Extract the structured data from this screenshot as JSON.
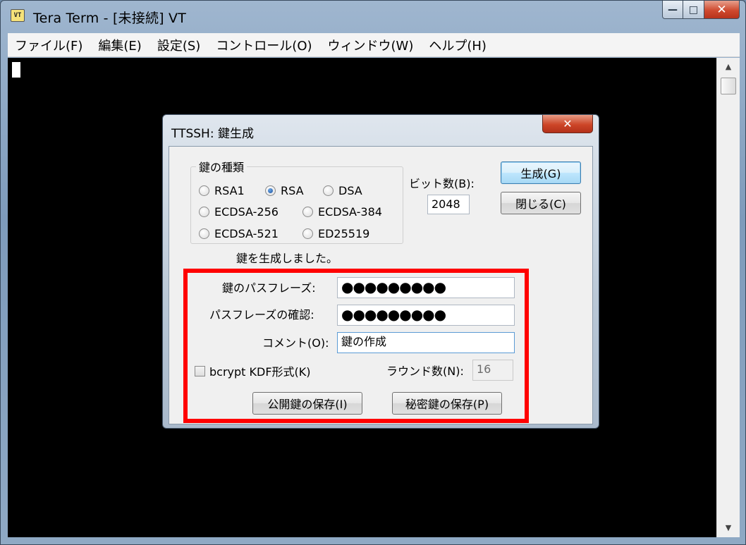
{
  "window": {
    "icon_text": "VT",
    "title": "Tera Term - [未接続] VT",
    "minimize_glyph": "—",
    "maximize_glyph": "□",
    "close_glyph": "✕"
  },
  "menu": [
    "ファイル(F)",
    "編集(E)",
    "設定(S)",
    "コントロール(O)",
    "ウィンドウ(W)",
    "ヘルプ(H)"
  ],
  "scrollbar": {
    "up_glyph": "▲",
    "down_glyph": "▼"
  },
  "dialog": {
    "title": "TTSSH: 鍵生成",
    "close_glyph": "✕",
    "key_type_group": "鍵の種類",
    "key_types": {
      "rsa1": "RSA1",
      "rsa": "RSA",
      "dsa": "DSA",
      "ecdsa256": "ECDSA-256",
      "ecdsa384": "ECDSA-384",
      "ecdsa521": "ECDSA-521",
      "ed25519": "ED25519"
    },
    "selected_key_type": "RSA",
    "bits_label": "ビット数(B):",
    "bits_value": "2048",
    "generate_button": "生成(G)",
    "close_button": "閉じる(C)",
    "status_text": "鍵を生成しました。",
    "passphrase_label": "鍵のパスフレーズ:",
    "passphrase_value": "●●●●●●●●●",
    "confirm_label": "パスフレーズの確認:",
    "confirm_value": "●●●●●●●●●",
    "comment_label": "コメント(O):",
    "comment_value": "鍵の作成",
    "bcrypt_label": "bcrypt KDF形式(K)",
    "bcrypt_checked": false,
    "rounds_label": "ラウンド数(N):",
    "rounds_value": "16",
    "save_public_button": "公開鍵の保存(I)",
    "save_private_button": "秘密鍵の保存(P)"
  },
  "colors": {
    "highlight": "#ff0000",
    "terminal_bg": "#000000",
    "close_button": "#cd4628"
  }
}
